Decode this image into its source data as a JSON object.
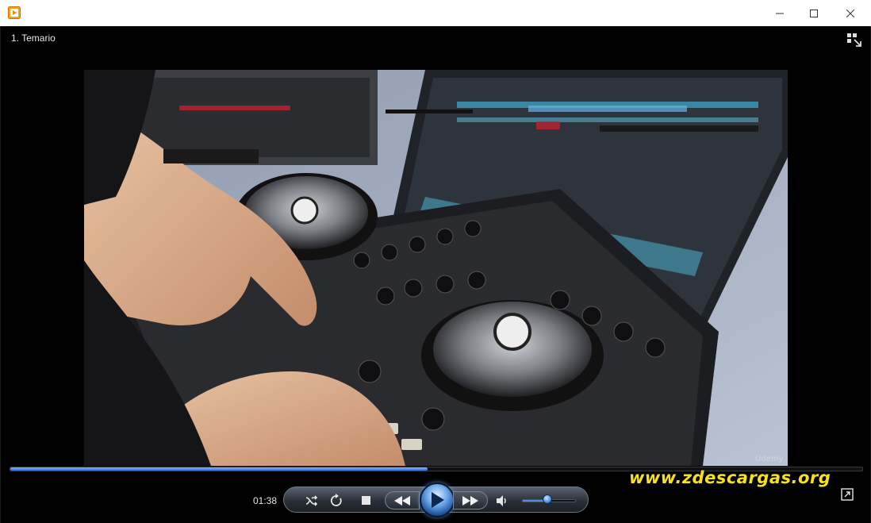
{
  "window": {
    "icon": "media-player-icon",
    "min_icon": "minimize-icon",
    "max_icon": "maximize-icon",
    "close_icon": "close-icon"
  },
  "player": {
    "media_title": "1. Temario",
    "switch_icon": "switch-to-library-icon",
    "video_watermark": "Udemy",
    "seek_progress": 0.49,
    "elapsed_time": "01:38",
    "volume_level": 0.44,
    "overlay_text": "www.zdescargas.org",
    "fullscreen_icon": "fullscreen-icon"
  },
  "colors": {
    "accent": "#3b7fd8",
    "watermark": "#f6e11b",
    "background": "#000000"
  }
}
